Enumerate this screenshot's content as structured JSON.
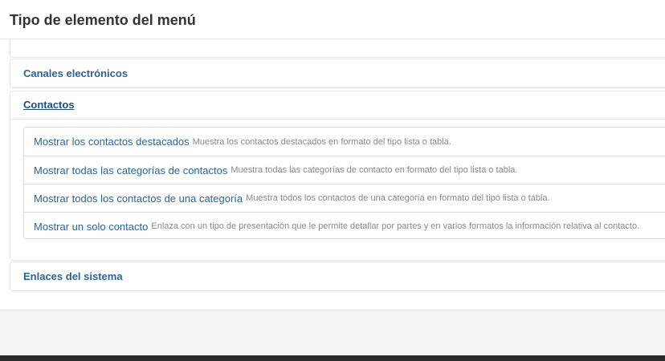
{
  "modal": {
    "title": "Tipo de elemento del menú"
  },
  "sections": [
    {
      "label": "Canales electrónicos",
      "expanded": false
    },
    {
      "label": "Contactos",
      "expanded": true
    },
    {
      "label": "Enlaces del sistema",
      "expanded": false
    }
  ],
  "contactos_items": [
    {
      "title": "Mostrar los contactos destacados",
      "description": "Muestra los contactos destacados en formato del tipo lista o tabla."
    },
    {
      "title": "Mostrar todas las categorías de contactos",
      "description": "Muestra todas las categorías de contacto en formato del tipo lista o tabla."
    },
    {
      "title": "Mostrar todos los contactos de una categoría",
      "description": "Muestra todos los contactos de una categoría en formato del tipo lista o tabla."
    },
    {
      "title": "Mostrar un solo contacto",
      "description": "Enlaza con un tipo de presentación que le permite detallar por partes y en varios formatos la información relativa al contacto."
    }
  ],
  "colors": {
    "link": "#2a6496",
    "active_link": "#1d4f78",
    "description": "#888888",
    "footer_bg": "#f4f4f4",
    "bottom_bar": "#2b2b2b"
  }
}
